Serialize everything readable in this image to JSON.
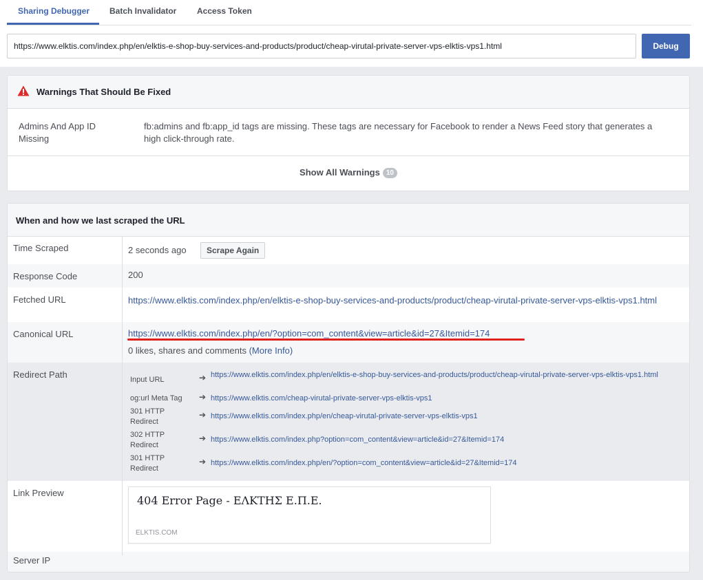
{
  "tabs": [
    {
      "label": "Sharing Debugger",
      "active": true
    },
    {
      "label": "Batch Invalidator",
      "active": false
    },
    {
      "label": "Access Token",
      "active": false
    }
  ],
  "url_input": {
    "value": "https://www.elktis.com/index.php/en/elktis-e-shop-buy-services-and-products/product/cheap-virutal-private-server-vps-elktis-vps1.html"
  },
  "debug_button": "Debug",
  "warnings": {
    "title": "Warnings That Should Be Fixed",
    "icon": "warning-triangle-icon",
    "items": [
      {
        "label": "Admins And App ID Missing",
        "text": "fb:admins and fb:app_id tags are missing. These tags are necessary for Facebook to render a News Feed story that generates a high click-through rate."
      }
    ],
    "show_all_label": "Show All Warnings",
    "count": "10"
  },
  "scrape": {
    "title": "When and how we last scraped the URL",
    "time_scraped_label": "Time Scraped",
    "time_scraped_value": "2 seconds ago",
    "scrape_again_button": "Scrape Again",
    "response_code_label": "Response Code",
    "response_code_value": "200",
    "fetched_url_label": "Fetched URL",
    "fetched_url_value": "https://www.elktis.com/index.php/en/elktis-e-shop-buy-services-and-products/product/cheap-virutal-private-server-vps-elktis-vps1.html",
    "canonical_url_label": "Canonical URL",
    "canonical_url_value": "https://www.elktis.com/index.php/en/?option=com_content&view=article&id=27&Itemid=174",
    "likes_text": "0 likes, shares and comments",
    "more_info_label": "(More Info)",
    "redirect_path_label": "Redirect Path",
    "redirects": [
      {
        "label": "Input URL",
        "url": "https://www.elktis.com/index.php/en/elktis-e-shop-buy-services-and-products/product/cheap-virutal-private-server-vps-elktis-vps1.html"
      },
      {
        "label": "og:url Meta Tag",
        "url": "https://www.elktis.com/cheap-virutal-private-server-vps-elktis-vps1"
      },
      {
        "label": "301 HTTP Redirect",
        "url": "https://www.elktis.com/index.php/en/cheap-virutal-private-server-vps-elktis-vps1"
      },
      {
        "label": "302 HTTP Redirect",
        "url": "https://www.elktis.com/index.php?option=com_content&view=article&id=27&Itemid=174"
      },
      {
        "label": "301 HTTP Redirect",
        "url": "https://www.elktis.com/index.php/en/?option=com_content&view=article&id=27&Itemid=174"
      }
    ],
    "link_preview_label": "Link Preview",
    "preview_title": "404 Error Page - ΕΛΚΤΗΣ Ε.Π.Ε.",
    "preview_domain": "ELKTIS.COM",
    "server_ip_label": "Server IP"
  },
  "colors": {
    "accent": "#4267b2",
    "link": "#365899",
    "annotation": "#e0201c",
    "warning": "#e02a2a"
  }
}
